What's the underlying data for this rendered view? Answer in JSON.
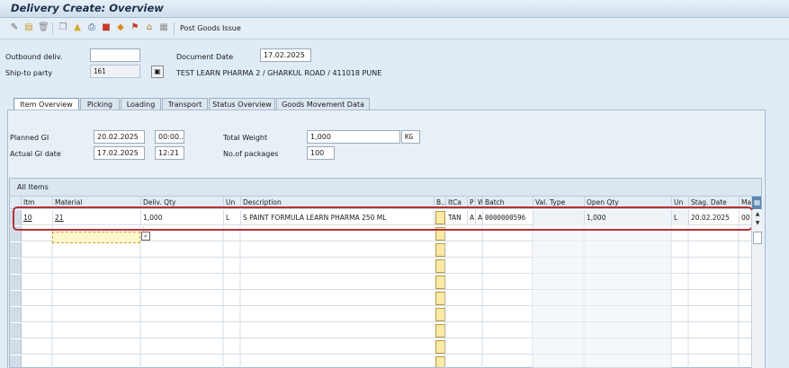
{
  "window": {
    "title": "Delivery  Create: Overview"
  },
  "toolbar": {
    "icons": [
      "display-change-icon",
      "document-icon",
      "delete-icon",
      "copy-icon",
      "header-icon",
      "print-icon",
      "hierarchy-icon",
      "picking-icon",
      "flag-icon",
      "loading-icon",
      "grid-icon"
    ],
    "post_goods_issue": "Post Goods Issue"
  },
  "header": {
    "outbound_deliv_label": "Outbound deliv.",
    "outbound_deliv_value": "",
    "document_date_label": "Document Date",
    "document_date_value": "17.02.2025",
    "ship_to_label": "Ship-to party",
    "ship_to_value": "161",
    "ship_to_address": "TEST LEARN PHARMA 2 / GHARKUL ROAD / 411018 PUNE"
  },
  "tabs": [
    "Item Overview",
    "Picking",
    "Loading",
    "Transport",
    "Status Overview",
    "Goods Movement Data"
  ],
  "overview": {
    "planned_gi_label": "Planned GI",
    "planned_gi_date": "20.02.2025",
    "planned_gi_time": "00:00..",
    "actual_gi_label": "Actual GI date",
    "actual_gi_date": "17.02.2025",
    "actual_gi_time": "12:21",
    "total_weight_label": "Total Weight",
    "total_weight_value": "1,000",
    "total_weight_unit": "KG",
    "packages_label": "No.of packages",
    "packages_value": "100"
  },
  "items": {
    "title": "All Items",
    "columns": [
      "Itm",
      "Material",
      "Deliv. Qty",
      "Un",
      "Description",
      "B..",
      "ItCa",
      "P",
      "W",
      "Batch",
      "Val. Type",
      "Open Qty",
      "Un",
      "Stag. Date",
      "Ma"
    ],
    "rows": [
      {
        "itm": "10",
        "material": "21",
        "deliv_qty": "1,000",
        "un": "L",
        "description": "S PAINT FORMULA LEARN PHARMA 250 ML",
        "itca": "TAN",
        "p": "A",
        "w": "A",
        "batch": "0000000596",
        "val_type": "",
        "open_qty": "1,000",
        "un2": "L",
        "stag_date": "20.02.2025",
        "ma": "00"
      }
    ]
  }
}
